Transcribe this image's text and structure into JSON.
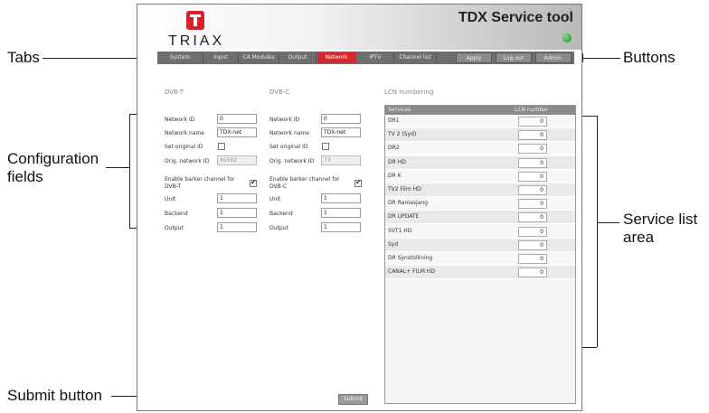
{
  "callouts": {
    "tabs": "Tabs",
    "buttons": "Buttons",
    "config": "Configuration fields",
    "service": "Service list area",
    "submit": "Submit button"
  },
  "app": {
    "brand": "TRIAX",
    "title": "TDX Service tool",
    "status_led_color": "#2fa82f",
    "accent_color": "#d9262f"
  },
  "tabs": [
    "System",
    "Input",
    "CA Modules",
    "Output",
    "Network",
    "IPTV",
    "Channel list"
  ],
  "active_tab": "Network",
  "buttons": [
    "Apply",
    "Log out",
    "Admin."
  ],
  "dvbt": {
    "title": "DVB-T",
    "network_id_label": "Network ID",
    "network_id": "0",
    "network_name_label": "Network name",
    "network_name": "TDX-net",
    "set_orig_label": "Set original ID",
    "set_orig_checked": false,
    "orig_network_label": "Orig. network ID",
    "orig_network": "45982",
    "barker_label_1": "Enable barker channel for",
    "barker_label_2": "DVB-T",
    "barker_checked": true,
    "unit_label": "Unit",
    "unit": "1",
    "backend_label": "Backend",
    "backend": "1",
    "output_label": "Output",
    "output": "1"
  },
  "dvbc": {
    "title": "DVB-C",
    "network_id_label": "Network ID",
    "network_id": "0",
    "network_name_label": "Network name",
    "network_name": "TDX-net",
    "set_orig_label": "Set original ID",
    "set_orig_checked": false,
    "orig_network_label": "Orig. network ID",
    "orig_network": "73",
    "barker_label_1": "Enable barker channel for",
    "barker_label_2": "DVB-C",
    "barker_checked": true,
    "unit_label": "Unit",
    "unit": "1",
    "backend_label": "Backend",
    "backend": "1",
    "output_label": "Output",
    "output": "1"
  },
  "lcn": {
    "title": "LCN numbering",
    "col_services": "Services",
    "col_lcn": "LCN number",
    "rows": [
      {
        "name": "DR1",
        "value": "0"
      },
      {
        "name": "TV 2 (Syd)",
        "value": "0"
      },
      {
        "name": "DR2",
        "value": "0"
      },
      {
        "name": "DR HD",
        "value": "0"
      },
      {
        "name": "DR K",
        "value": "0"
      },
      {
        "name": "TV2 Film HD",
        "value": "0"
      },
      {
        "name": "DR Ramasjang",
        "value": "0"
      },
      {
        "name": "DR UPDATE",
        "value": "0"
      },
      {
        "name": "SVT1 HD",
        "value": "0"
      },
      {
        "name": "Syd",
        "value": "0"
      },
      {
        "name": "DR Synstolkning",
        "value": "0"
      },
      {
        "name": "CANAL+ FILM HD",
        "value": "0"
      }
    ]
  },
  "submit_label": "Submit"
}
